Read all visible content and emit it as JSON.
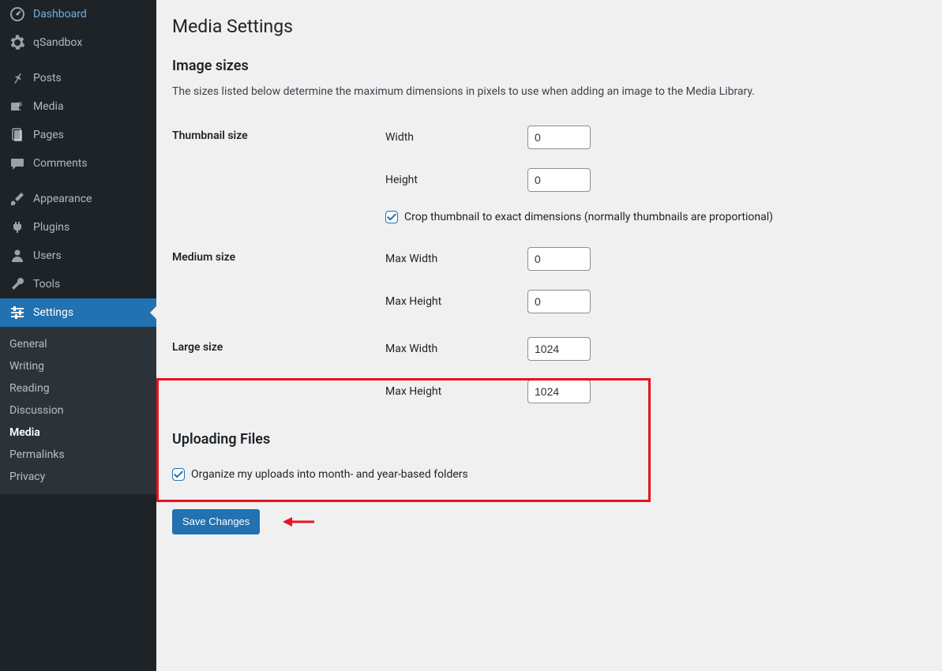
{
  "sidebar": {
    "dashboard": "Dashboard",
    "qsandbox": "qSandbox",
    "posts": "Posts",
    "media": "Media",
    "pages": "Pages",
    "comments": "Comments",
    "appearance": "Appearance",
    "plugins": "Plugins",
    "users": "Users",
    "tools": "Tools",
    "settings": "Settings"
  },
  "submenu": {
    "general": "General",
    "writing": "Writing",
    "reading": "Reading",
    "discussion": "Discussion",
    "media": "Media",
    "permalinks": "Permalinks",
    "privacy": "Privacy"
  },
  "page": {
    "title": "Media Settings",
    "image_sizes_heading": "Image sizes",
    "image_sizes_desc": "The sizes listed below determine the maximum dimensions in pixels to use when adding an image to the Media Library.",
    "thumbnail_label": "Thumbnail size",
    "thumbnail_width_label": "Width",
    "thumbnail_width_value": "0",
    "thumbnail_height_label": "Height",
    "thumbnail_height_value": "0",
    "thumbnail_crop_label": "Crop thumbnail to exact dimensions (normally thumbnails are proportional)",
    "thumbnail_crop_checked": true,
    "medium_label": "Medium size",
    "medium_width_label": "Max Width",
    "medium_width_value": "0",
    "medium_height_label": "Max Height",
    "medium_height_value": "0",
    "large_label": "Large size",
    "large_width_label": "Max Width",
    "large_width_value": "1024",
    "large_height_label": "Max Height",
    "large_height_value": "1024",
    "uploading_heading": "Uploading Files",
    "uploads_organize_label": "Organize my uploads into month- and year-based folders",
    "uploads_organize_checked": true,
    "save_button": "Save Changes"
  }
}
